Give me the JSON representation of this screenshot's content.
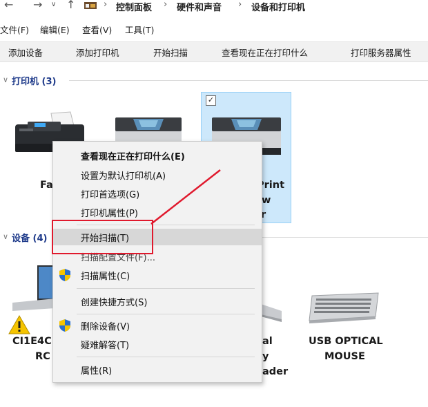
{
  "address": {
    "crumbs": [
      "控制面板",
      "硬件和声音",
      "设备和打印机"
    ]
  },
  "menubar": {
    "file": "文件(F)",
    "edit": "编辑(E)",
    "view": "查看(V)",
    "tools": "工具(T)"
  },
  "toolbar": {
    "add_device": "添加设备",
    "add_printer": "添加打印机",
    "start_scan": "开始扫描",
    "see_printing": "查看现在正在打印什么",
    "print_server": "打印服务器属性"
  },
  "groups": {
    "printers": "打印机 (3)",
    "devices": "设备 (4)"
  },
  "printers": [
    {
      "label": "Fa"
    },
    {
      "label": ""
    },
    {
      "label_lines": [
        "Print",
        "lw",
        "r"
      ]
    }
  ],
  "devices": [
    {
      "label_lines": [
        "CI1E4C",
        "RC"
      ]
    },
    {
      "label_lines": [
        "al",
        "y",
        "ader"
      ]
    },
    {
      "label_lines": [
        "USB OPTICAL",
        "MOUSE"
      ]
    }
  ],
  "context_menu": {
    "items": [
      {
        "label": "查看现在正在打印什么(E)"
      },
      {
        "label": "设置为默认打印机(A)"
      },
      {
        "label": "打印首选项(G)"
      },
      {
        "label": "打印机属性(P)"
      },
      {
        "label": "开始扫描(T)"
      },
      {
        "label": "扫描配置文件(F)..."
      },
      {
        "label": "扫描属性(C)"
      },
      {
        "label": "创建快捷方式(S)"
      },
      {
        "label": "删除设备(V)"
      },
      {
        "label": "疑难解答(T)"
      },
      {
        "label": "属性(R)"
      }
    ]
  },
  "colors": {
    "selection": "#cde8fb",
    "annotation": "#e0192d",
    "group_header": "#1e3a8a"
  }
}
